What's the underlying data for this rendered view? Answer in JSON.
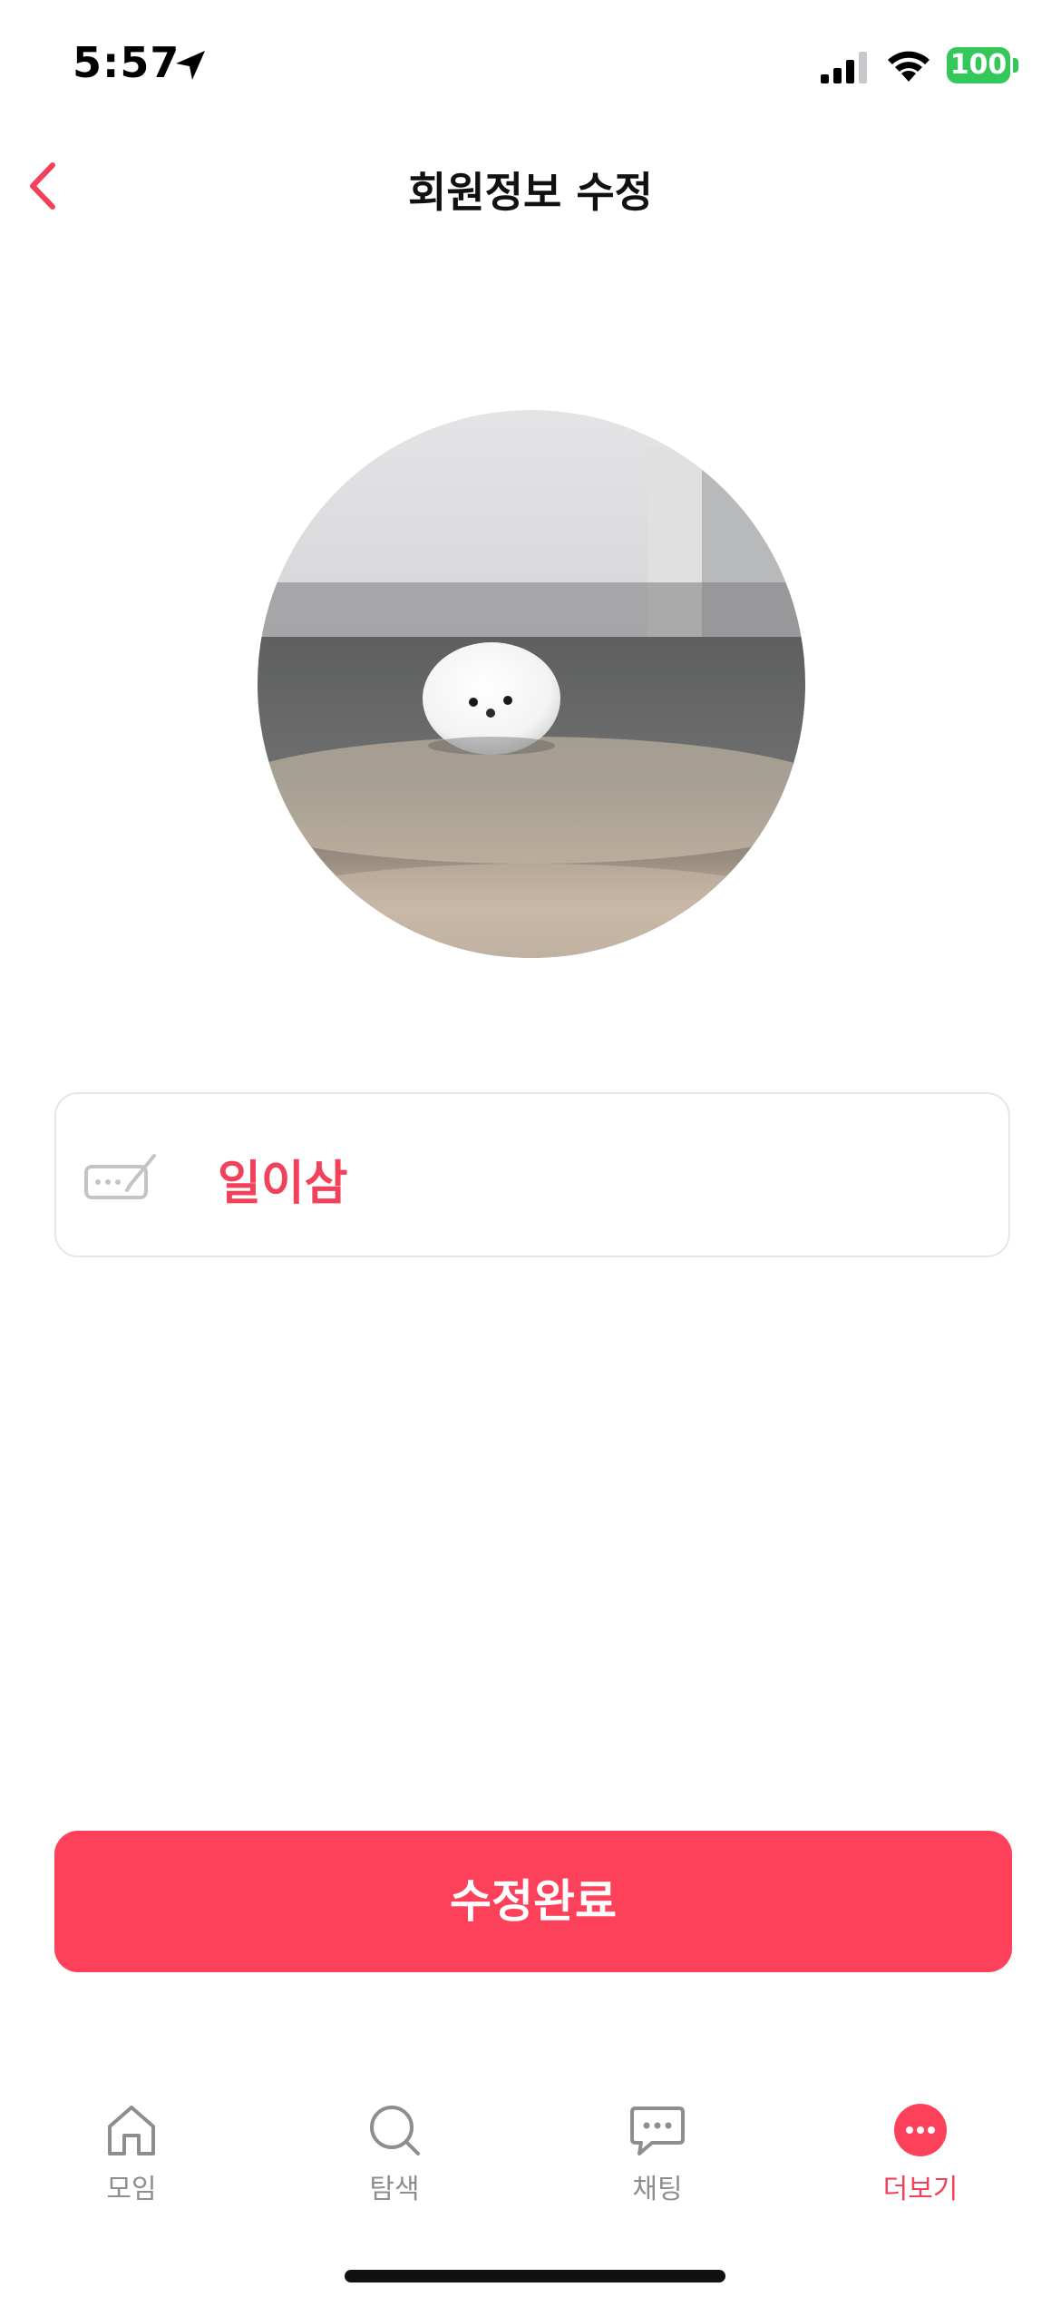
{
  "status_bar": {
    "time": "5:57",
    "battery": "100"
  },
  "header": {
    "title": "회원정보 수정"
  },
  "profile": {
    "nickname": "일이삼"
  },
  "actions": {
    "submit_label": "수정완료"
  },
  "tabs": [
    {
      "label": "모임",
      "icon": "home-icon",
      "active": false
    },
    {
      "label": "탐색",
      "icon": "search-icon",
      "active": false
    },
    {
      "label": "채팅",
      "icon": "chat-icon",
      "active": false
    },
    {
      "label": "더보기",
      "icon": "more-icon",
      "active": true
    }
  ],
  "colors": {
    "accent": "#fe415b",
    "accent_text": "#f1415b",
    "inactive_tab": "#8e8e8e",
    "battery": "#34c759"
  }
}
